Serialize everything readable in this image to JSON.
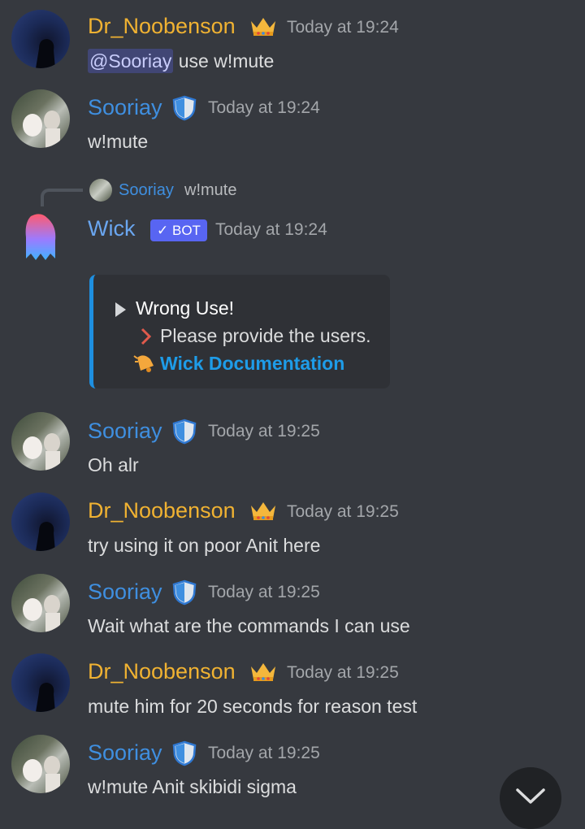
{
  "messages": [
    {
      "author": "Dr_Noobenson",
      "badge_icon": "crown-icon",
      "timestamp": "Today at 19:24",
      "mention": "@Sooriay",
      "text": "use w!mute"
    },
    {
      "author": "Sooriay",
      "badge_icon": "shield-icon",
      "timestamp": "Today at 19:24",
      "text": "w!mute"
    },
    {
      "reply": {
        "author": "Sooriay",
        "text": "w!mute"
      },
      "author": "Wick",
      "bot_tag": "BOT",
      "bot_check": "✓",
      "timestamp": "Today at 19:24",
      "embed": {
        "accent": "#1e8fe0",
        "title": "Wrong Use!",
        "line": "Please provide the users.",
        "link": "Wick Documentation",
        "link_color": "#1e9ce8"
      }
    },
    {
      "author": "Sooriay",
      "badge_icon": "shield-icon",
      "timestamp": "Today at 19:25",
      "text": "Oh alr"
    },
    {
      "author": "Dr_Noobenson",
      "badge_icon": "crown-icon",
      "timestamp": "Today at 19:25",
      "text": "try using it on poor Anit here"
    },
    {
      "author": "Sooriay",
      "badge_icon": "shield-icon",
      "timestamp": "Today at 19:25",
      "text": "Wait what are the commands I can use"
    },
    {
      "author": "Dr_Noobenson",
      "badge_icon": "crown-icon",
      "timestamp": "Today at 19:25",
      "text": "mute him for 20 seconds for reason test"
    },
    {
      "author": "Sooriay",
      "badge_icon": "shield-icon",
      "timestamp": "Today at 19:25",
      "text": "w!mute Anit skibidi sigma"
    }
  ],
  "colors": {
    "background": "#36393f",
    "noob_name": "#f0b232",
    "sooriay_name": "#3f8fe0",
    "bot_tag": "#5865f2"
  },
  "scroll_button_icon": "chevron-down-icon"
}
